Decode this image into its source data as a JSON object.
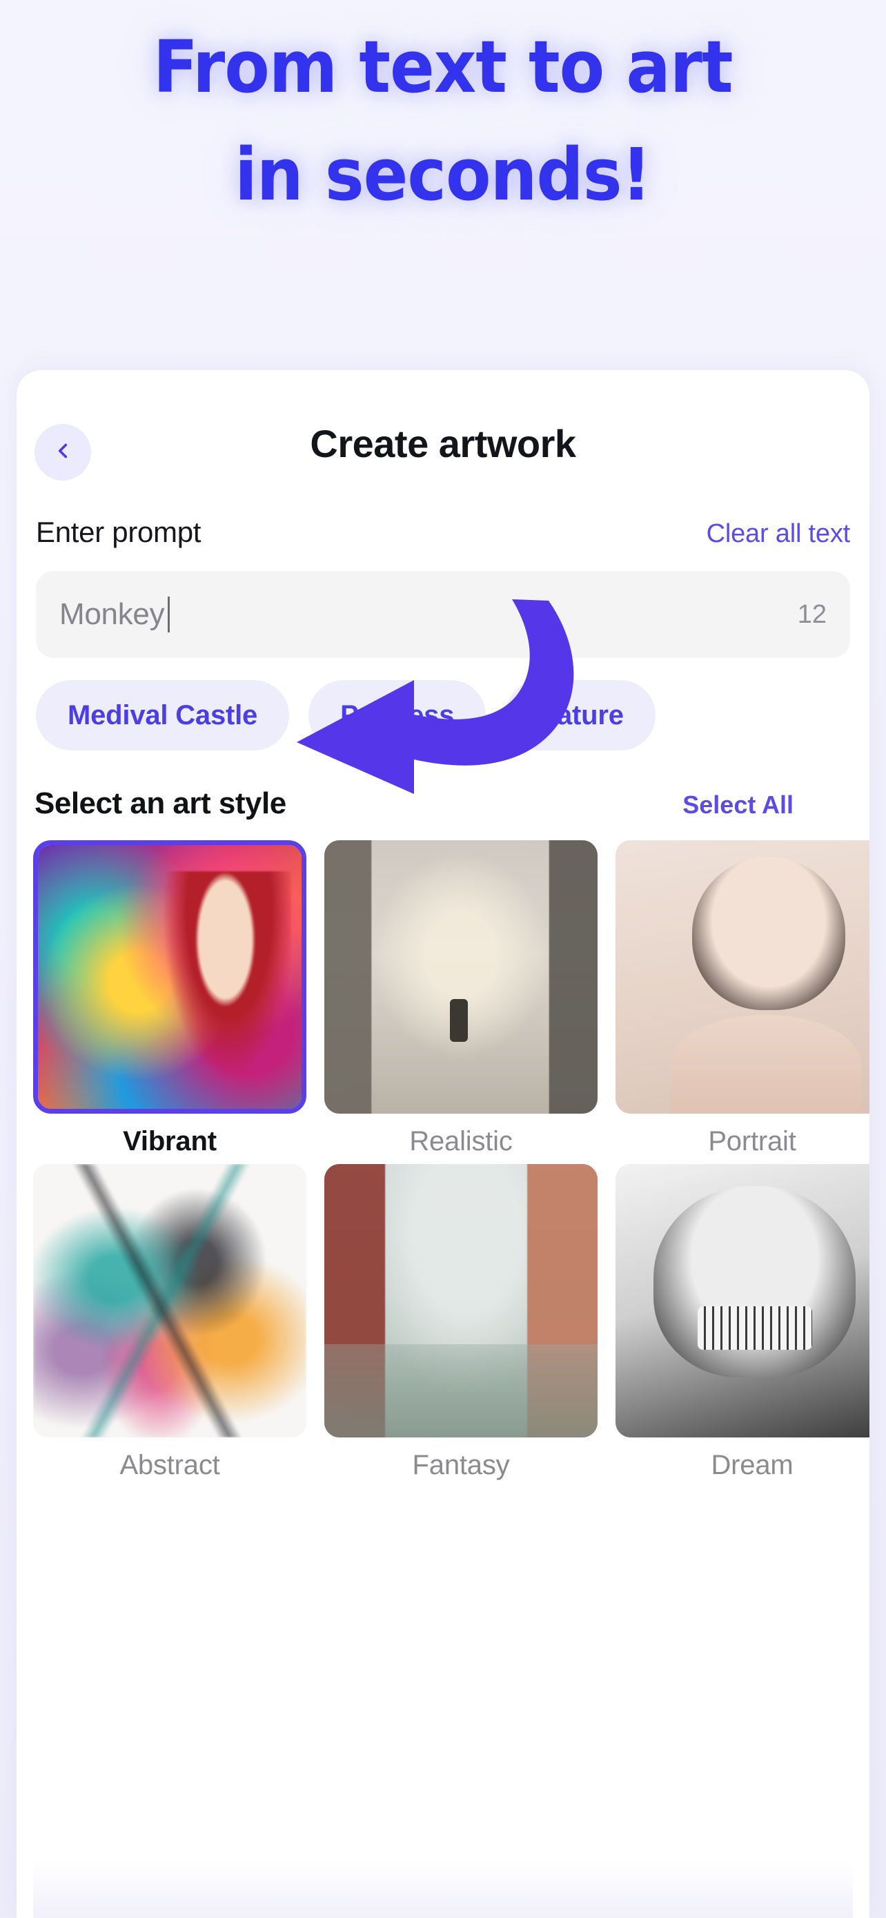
{
  "hero": {
    "line1": "From text to art",
    "line2": "in seconds!",
    "color": "#3333ee"
  },
  "header": {
    "title": "Create artwork",
    "back_icon": "chevron-left-icon"
  },
  "prompt": {
    "label": "Enter prompt",
    "clear_label": "Clear all text",
    "value": "Monkey",
    "placeholder": "Monkey",
    "char_count": "12"
  },
  "chips": [
    {
      "label": "Medival Castle"
    },
    {
      "label": "Princess"
    },
    {
      "label": "Nature"
    }
  ],
  "art_style": {
    "title": "Select an art style",
    "select_all_label": "Select All",
    "tiles": [
      {
        "label": "Vibrant",
        "selected": true,
        "art": "art-vibrant"
      },
      {
        "label": "Realistic",
        "selected": false,
        "art": "art-realistic"
      },
      {
        "label": "Portrait",
        "selected": false,
        "art": "art-portrait"
      },
      {
        "label": "Abstract",
        "selected": false,
        "art": "art-abstract"
      },
      {
        "label": "Fantasy",
        "selected": false,
        "art": "art-fantasy"
      },
      {
        "label": "Dream",
        "selected": false,
        "art": "art-dream"
      }
    ]
  },
  "accent": {
    "purple": "#5b4ce6",
    "chip_bg": "#eeedfc",
    "arrow": "#5536e8"
  }
}
